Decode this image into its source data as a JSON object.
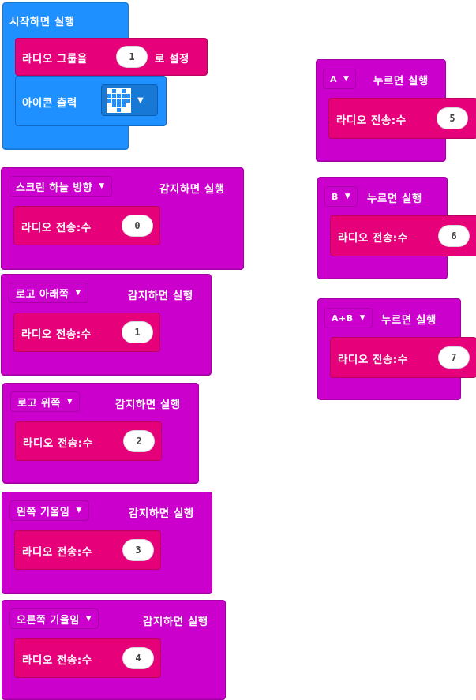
{
  "start_block": {
    "label": "시작하면 실행",
    "radio_group_label_prefix": "라디오 그룹을",
    "radio_group_value": "1",
    "radio_group_label_suffix": "로 설정",
    "show_icon_label": "아이콘 출력",
    "icon_name": "heart-icon"
  },
  "gesture_blocks": [
    {
      "dropdown": "스크린 하늘 방향",
      "event": "감지하면 실행",
      "send_label": "라디오 전송:수",
      "value": "0"
    },
    {
      "dropdown": "로고 아래쪽",
      "event": "감지하면 실행",
      "send_label": "라디오 전송:수",
      "value": "1"
    },
    {
      "dropdown": "로고 위쪽",
      "event": "감지하면 실행",
      "send_label": "라디오 전송:수",
      "value": "2"
    },
    {
      "dropdown": "왼쪽 기울임",
      "event": "감지하면 실행",
      "send_label": "라디오 전송:수",
      "value": "3"
    },
    {
      "dropdown": "오른쪽 기울임",
      "event": "감지하면 실행",
      "send_label": "라디오 전송:수",
      "value": "4"
    }
  ],
  "button_blocks": [
    {
      "dropdown": "A",
      "event": "누르면 실행",
      "send_label": "라디오 전송:수",
      "value": "5"
    },
    {
      "dropdown": "B",
      "event": "누르면 실행",
      "send_label": "라디오 전송:수",
      "value": "6"
    },
    {
      "dropdown": "A+B",
      "event": "누르면 실행",
      "send_label": "라디오 전송:수",
      "value": "7"
    }
  ],
  "colors": {
    "event_purple": "#cc00cc",
    "radio_pink": "#e6007a",
    "basic_blue": "#1e90ff"
  },
  "heart_pattern": [
    0,
    1,
    0,
    1,
    0,
    1,
    1,
    1,
    1,
    1,
    1,
    1,
    1,
    1,
    1,
    0,
    1,
    1,
    1,
    0,
    0,
    0,
    1,
    0,
    0
  ]
}
